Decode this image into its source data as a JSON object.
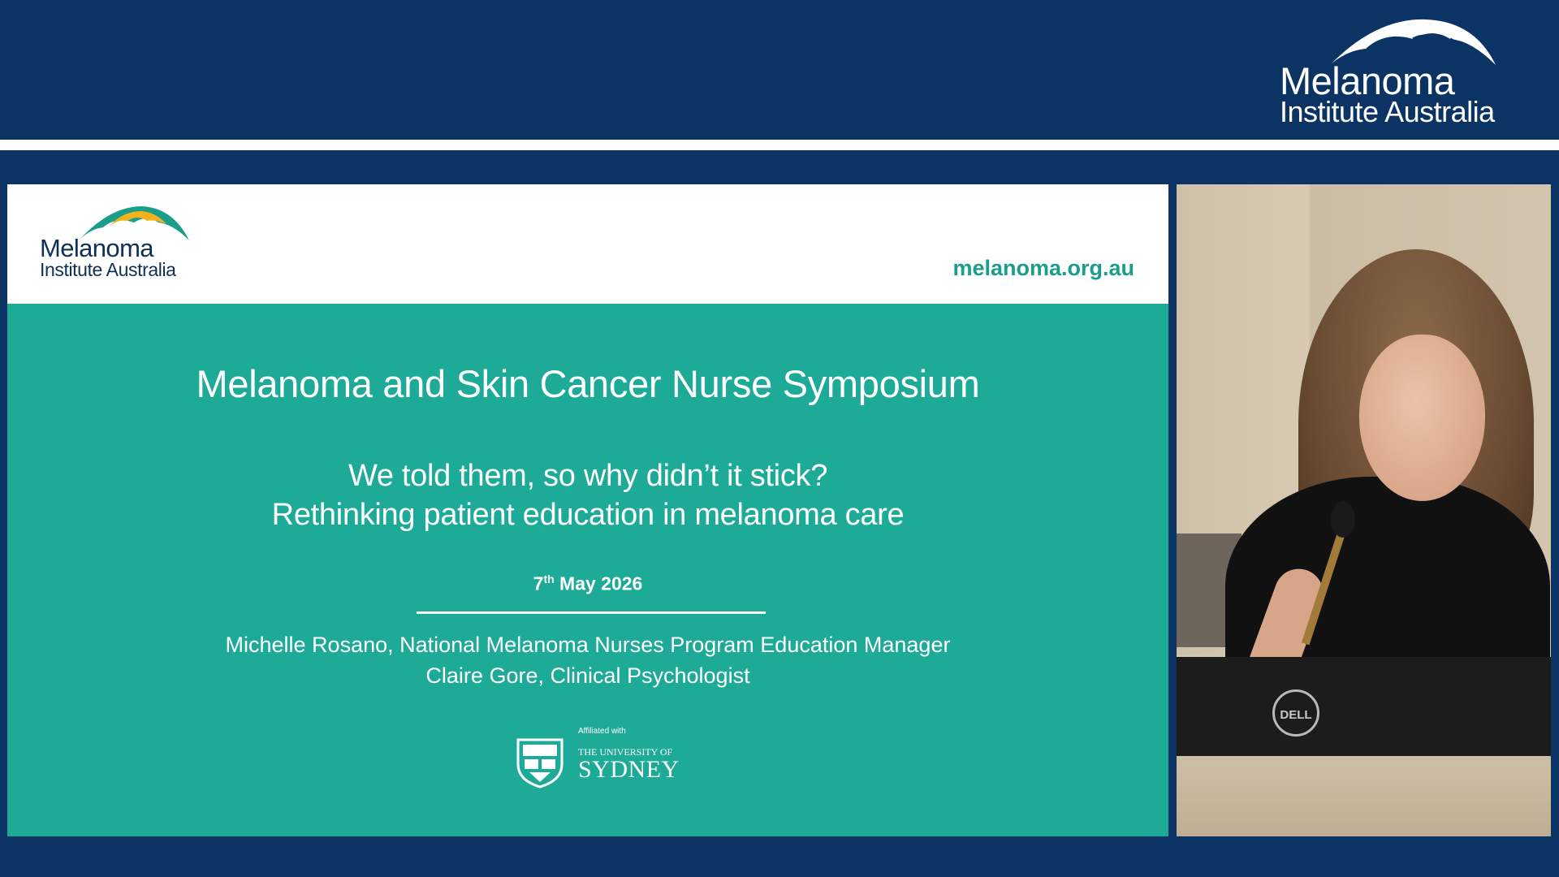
{
  "broadcast": {
    "logo_line1": "Melanoma",
    "logo_line2": "Institute Australia"
  },
  "slide": {
    "logo_line1": "Melanoma",
    "logo_line2": "Institute Australia",
    "website": "melanoma.org.au",
    "event_title": "Melanoma and Skin Cancer Nurse Symposium",
    "talk_title_line1": "We told them, so why didn’t it stick?",
    "talk_title_line2": "Rethinking patient education in melanoma care",
    "date_day": "7",
    "date_suffix": "th",
    "date_rest": " May 2026",
    "presenter1": "Michelle Rosano, National Melanoma Nurses Program Education Manager",
    "presenter2": "Claire Gore, Clinical Psychologist",
    "affiliation_label": "Affiliated with",
    "university_small": "THE UNIVERSITY OF",
    "university_big": "SYDNEY"
  },
  "camera": {
    "monitor_brand": "DELL"
  },
  "colors": {
    "banner": "#0b3465",
    "slide_teal": "#1dab97",
    "logo_teal": "#1a9d8a",
    "logo_yellow": "#f2b21c"
  }
}
